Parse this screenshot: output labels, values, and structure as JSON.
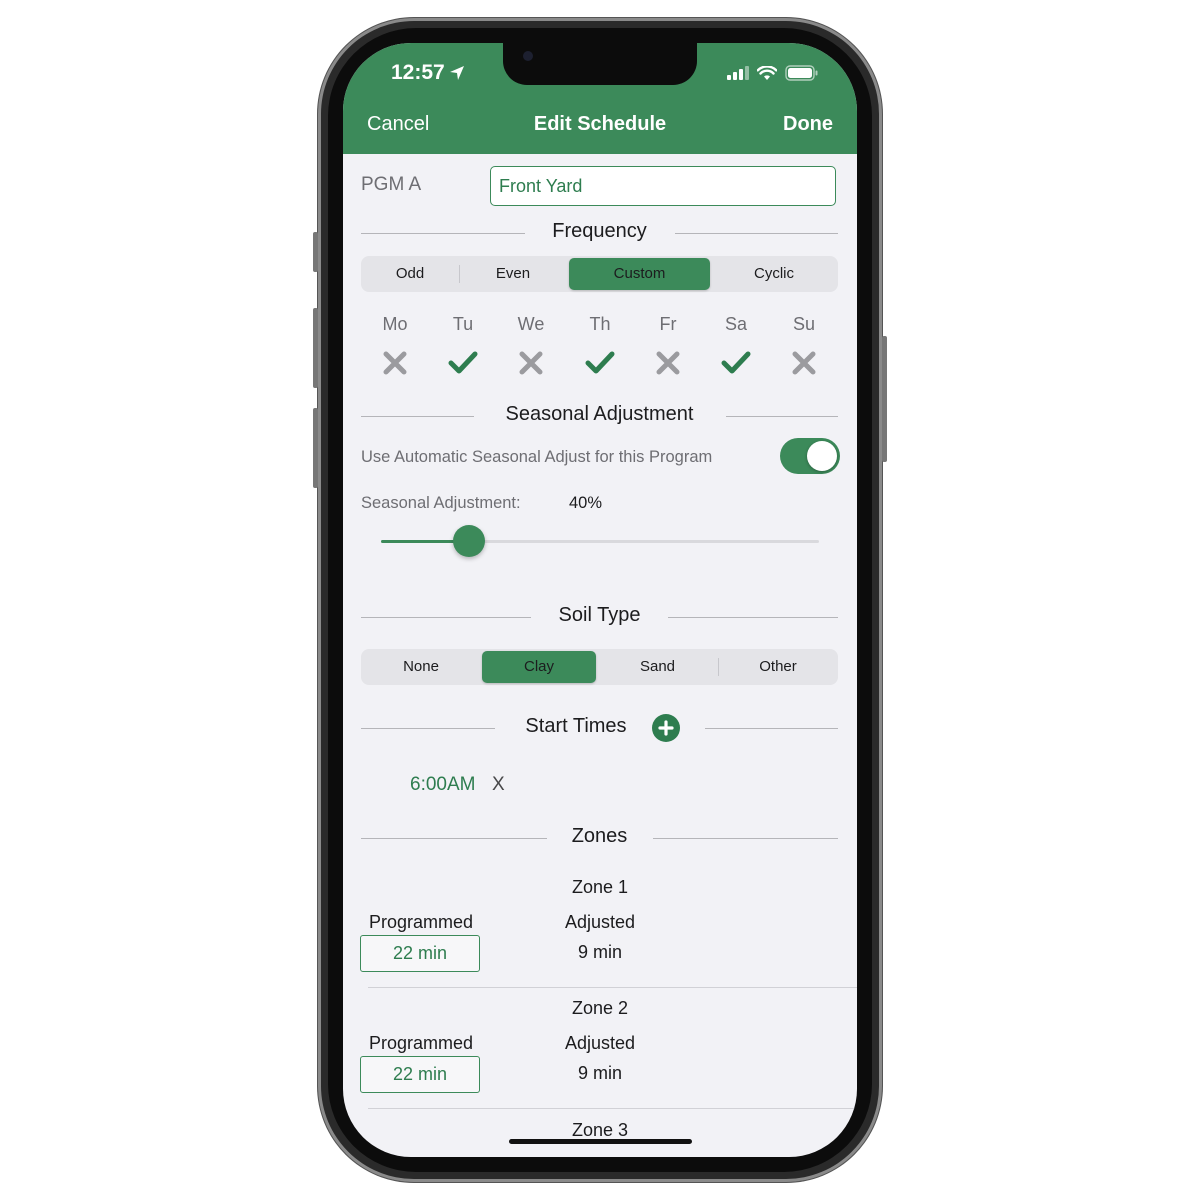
{
  "status_bar": {
    "time": "12:57"
  },
  "nav": {
    "cancel": "Cancel",
    "title": "Edit Schedule",
    "done": "Done"
  },
  "program": {
    "label": "PGM A",
    "name": "Front Yard"
  },
  "frequency": {
    "title": "Frequency",
    "options": [
      "Odd",
      "Even",
      "Custom",
      "Cyclic"
    ],
    "selected": "Custom",
    "days": [
      {
        "label": "Mo",
        "selected": false
      },
      {
        "label": "Tu",
        "selected": true
      },
      {
        "label": "We",
        "selected": false
      },
      {
        "label": "Th",
        "selected": true
      },
      {
        "label": "Fr",
        "selected": false
      },
      {
        "label": "Sa",
        "selected": true
      },
      {
        "label": "Su",
        "selected": false
      }
    ]
  },
  "seasonal": {
    "title": "Seasonal Adjustment",
    "toggle_label": "Use Automatic Seasonal Adjust for this Program",
    "toggle_on": true,
    "adjustment_label": "Seasonal Adjustment:",
    "adjustment_value": "40%",
    "slider_fraction": 0.2
  },
  "soil": {
    "title": "Soil Type",
    "options": [
      "None",
      "Clay",
      "Sand",
      "Other"
    ],
    "selected": "Clay"
  },
  "start_times": {
    "title": "Start Times",
    "items": [
      {
        "time": "6:00AM",
        "remove": "X"
      }
    ]
  },
  "zones": {
    "title": "Zones",
    "items": [
      {
        "name": "Zone 1",
        "programmed_label": "Programmed",
        "programmed": "22 min",
        "adjusted_label": "Adjusted",
        "adjusted": "9 min"
      },
      {
        "name": "Zone 2",
        "programmed_label": "Programmed",
        "programmed": "22 min",
        "adjusted_label": "Adjusted",
        "adjusted": "9 min"
      },
      {
        "name": "Zone 3"
      }
    ]
  },
  "colors": {
    "accent": "#3c8a5a",
    "accent_text": "#2e7d4f",
    "background": "#f2f2f6",
    "inactive_mark": "#9b9b9f"
  }
}
